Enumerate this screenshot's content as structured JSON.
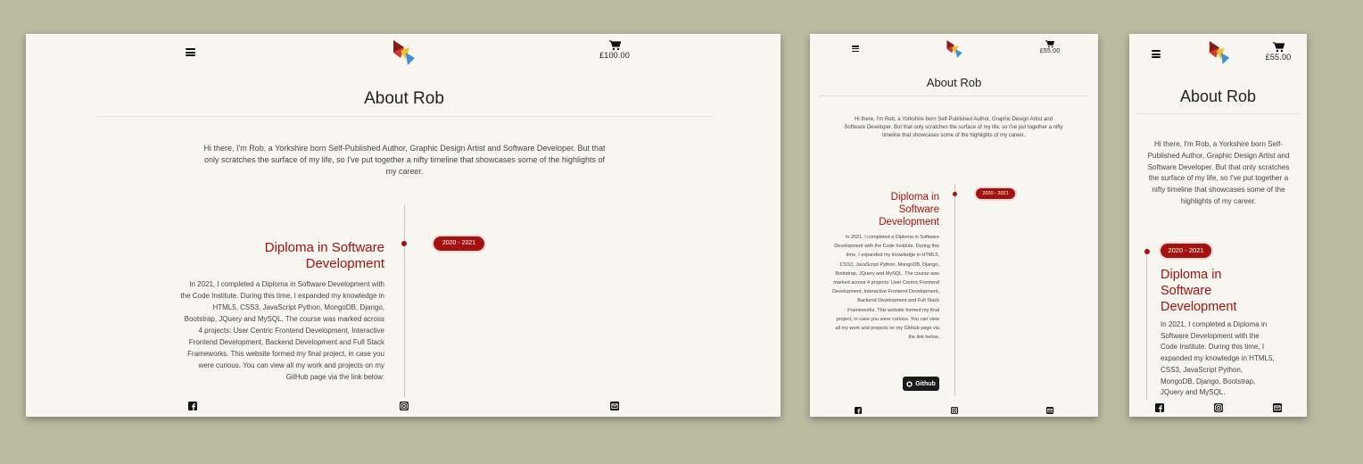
{
  "desktop": {
    "price": "£100.00",
    "title": "About Rob",
    "intro": "Hi there, I'm Rob, a Yorkshire born Self-Published Author, Graphic Design Artist and Software Developer. But that only scratches the surface of my life, so I've put together a nifty timeline that showcases some of the highlights of my career.",
    "badge": "2020 - 2021",
    "heading": "Diploma in Software Development",
    "body": "In 2021, I completed a Diploma in Software Development with the Code Institute. During this time, I expanded my knowledge in HTML5, CSS3, JavaScript Python, MongoDB, Django, Bootstrap, JQuery and MySQL. The course was marked across 4 projects: User Centric Frontend Development, Interactive Frontend Development, Backend Development and Full Stack Frameworks. This website formed my final project, in case you were curious. You can view all my work and projects on my GitHub page via the link below:"
  },
  "tablet": {
    "price": "£55.00",
    "title": "About Rob",
    "intro": "Hi there, I'm Rob, a Yorkshire born Self-Published Author, Graphic Design Artist and Software Developer. But that only scratches the surface of my life, so I've put together a nifty timeline that showcases some of the highlights of my career.",
    "badge": "2020 - 2021",
    "heading": "Diploma in Software Development",
    "body": "In 2021, I completed a Diploma in Software Development with the Code Institute. During this time, I expanded my knowledge in HTML5, CSS3, JavaScript Python, MongoDB, Django, Bootstrap, JQuery and MySQL. The course was marked across 4 projects: User Centric Frontend Development, Interactive Frontend Development, Backend Development and Full Stack Frameworks. This website formed my final project, in case you were curious. You can view all my work and projects on my GitHub page via the link below.",
    "github_label": "Github"
  },
  "mobile": {
    "price": "£55.00",
    "title": "About Rob",
    "intro": "Hi there, I'm Rob, a Yorkshire born Self-Published Author, Graphic Design Artist and Software Developer. But that only scratches the surface of my life, so I've put together a nifty timeline that showcases some of the highlights of my career.",
    "badge": "2020 - 2021",
    "heading": "Diploma in Software Development",
    "body": "In 2021, I completed a Diploma in Software Development with the Code Institute. During this time, I expanded my knowledge in HTML5, CSS3, JavaScript Python, MongoDB, Django, Bootstrap, JQuery and MySQL."
  },
  "icons": {
    "menu": "hamburger-icon",
    "logo": "origami-logo",
    "cart": "shopping-cart-icon",
    "facebook": "facebook-icon",
    "instagram": "instagram-icon",
    "email": "envelope-icon",
    "github": "github-icon"
  },
  "colors": {
    "page_background": "#bbbba2",
    "frame_background": "#f8f6f0",
    "accent": "#a3120f",
    "text": "#222222",
    "button": "#1b1b1b"
  }
}
